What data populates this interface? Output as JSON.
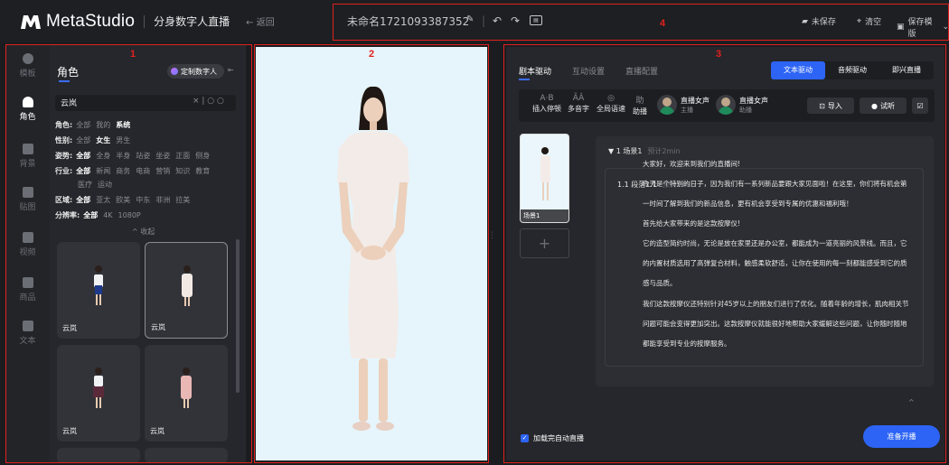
{
  "topbar": {
    "brand": "MetaStudio",
    "product": "分身数字人直播",
    "back": "← 返回",
    "project_name": "未命名1721093387352",
    "unsaved": "未保存",
    "clear": "清空",
    "save_template": "保存模版"
  },
  "annotations": {
    "a1": "1",
    "a2": "2",
    "a3": "3",
    "a4": "4"
  },
  "rail": [
    {
      "label": "模板",
      "icon": "template-icon"
    },
    {
      "label": "角色",
      "icon": "person-icon"
    },
    {
      "label": "背景",
      "icon": "background-icon"
    },
    {
      "label": "贴图",
      "icon": "sticker-icon"
    },
    {
      "label": "视频",
      "icon": "video-icon"
    },
    {
      "label": "商品",
      "icon": "product-icon"
    },
    {
      "label": "文本",
      "icon": "text-icon"
    }
  ],
  "left": {
    "tab": "角色",
    "custom_button": "定制数字人",
    "search_value": "云岚",
    "search_tools": "× | ○ ○",
    "filters": [
      {
        "label": "角色:",
        "options": [
          "全部",
          "我的",
          "系统"
        ],
        "active": 2
      },
      {
        "label": "性别:",
        "options": [
          "全部",
          "女生",
          "男生"
        ],
        "active": 1
      },
      {
        "label": "姿势:",
        "options": [
          "全部",
          "全身",
          "半身",
          "站姿",
          "坐姿",
          "正面",
          "侧身"
        ],
        "active": 0
      },
      {
        "label": "行业:",
        "options": [
          "全部",
          "新闻",
          "商务",
          "电商",
          "营销",
          "知识",
          "教育"
        ],
        "active": 0
      },
      {
        "label": "",
        "options": [
          "医疗",
          "运动"
        ],
        "active": -1
      },
      {
        "label": "区域:",
        "options": [
          "全部",
          "亚太",
          "欧美",
          "中东",
          "非洲",
          "拉美"
        ],
        "active": 0
      },
      {
        "label": "分辨率:",
        "options": [
          "全部",
          "4K",
          "1080P"
        ],
        "active": 0
      }
    ],
    "collapse": "^ 收起",
    "cards": [
      "云岚",
      "云岚",
      "云岚",
      "云岚"
    ]
  },
  "right": {
    "tabs": [
      "剧本驱动",
      "互动设置",
      "直播配置"
    ],
    "modes": [
      "文本驱动",
      "音频驱动",
      "即兴直播"
    ],
    "tools": [
      {
        "glyph": "A·B",
        "label": "插入停顿"
      },
      {
        "glyph": "ÃÂ",
        "label": "多音字"
      },
      {
        "glyph": "◎",
        "label": "全局语速"
      },
      {
        "glyph": "助",
        "label": "助播"
      }
    ],
    "voices": [
      {
        "name": "直播女声",
        "role": "主播"
      },
      {
        "name": "直播女声",
        "role": "助播"
      }
    ],
    "import": "导入",
    "listen": "试听",
    "scene_thumb_label": "场景1",
    "scene_title": "▼ 1  场景1",
    "scene_time": "预计2min",
    "para_title": "1.1  段落1.1",
    "para_time": "预计2min",
    "lines": [
      "大家好，欢迎来到我们的直播间!",
      "今天是个特别的日子，因为我们有一系列新品要跟大家见面啦！在这里，你们将有机会第",
      "一时间了解到我们的新品信息，更有机会享受到专属的优惠和福利哦！",
      "首先给大家带来的是这款按摩仪!",
      "它的造型简约时尚，无论是放在家里还是办公室，都能成为一道亮丽的风景线。而且，它",
      "的内置材质选用了高弹复合材料，触感柔软舒适，让你在使用的每一刻都能感受到它的质",
      "感与品质。",
      "我们这款按摩仪还特别针对45岁以上的朋友们进行了优化。随着年龄的增长，肌肉相关节",
      "问题可能会变得更加突出。这款按摩仪就能很好地帮助大家缓解这些问题，让你随时随地",
      "都能享受到专业的按摩服务。"
    ],
    "auto_live": "加载完自动直播",
    "start": "准备开播"
  }
}
